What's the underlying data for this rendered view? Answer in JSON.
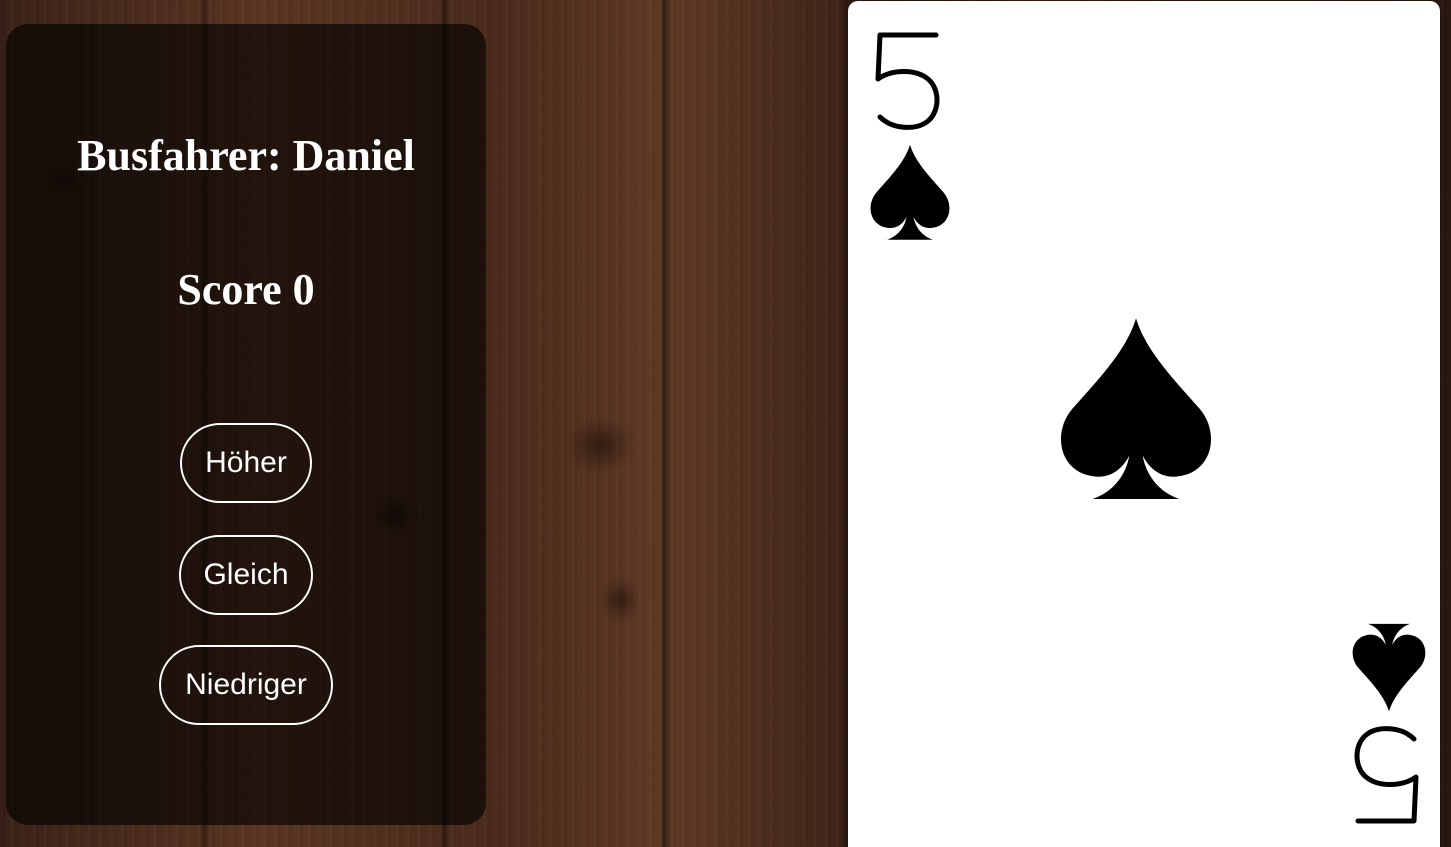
{
  "game": {
    "title": "Busfahrer: Daniel",
    "score_text": "Score 0"
  },
  "buttons": {
    "higher": "Höher",
    "equal": "Gleich",
    "lower": "Niedriger"
  },
  "card": {
    "rank": "5",
    "suit": "spades",
    "suit_icon": "spade-icon",
    "color": "#000000"
  },
  "colors": {
    "panel": "#000000",
    "text": "#ffffff",
    "card": "#ffffff"
  }
}
